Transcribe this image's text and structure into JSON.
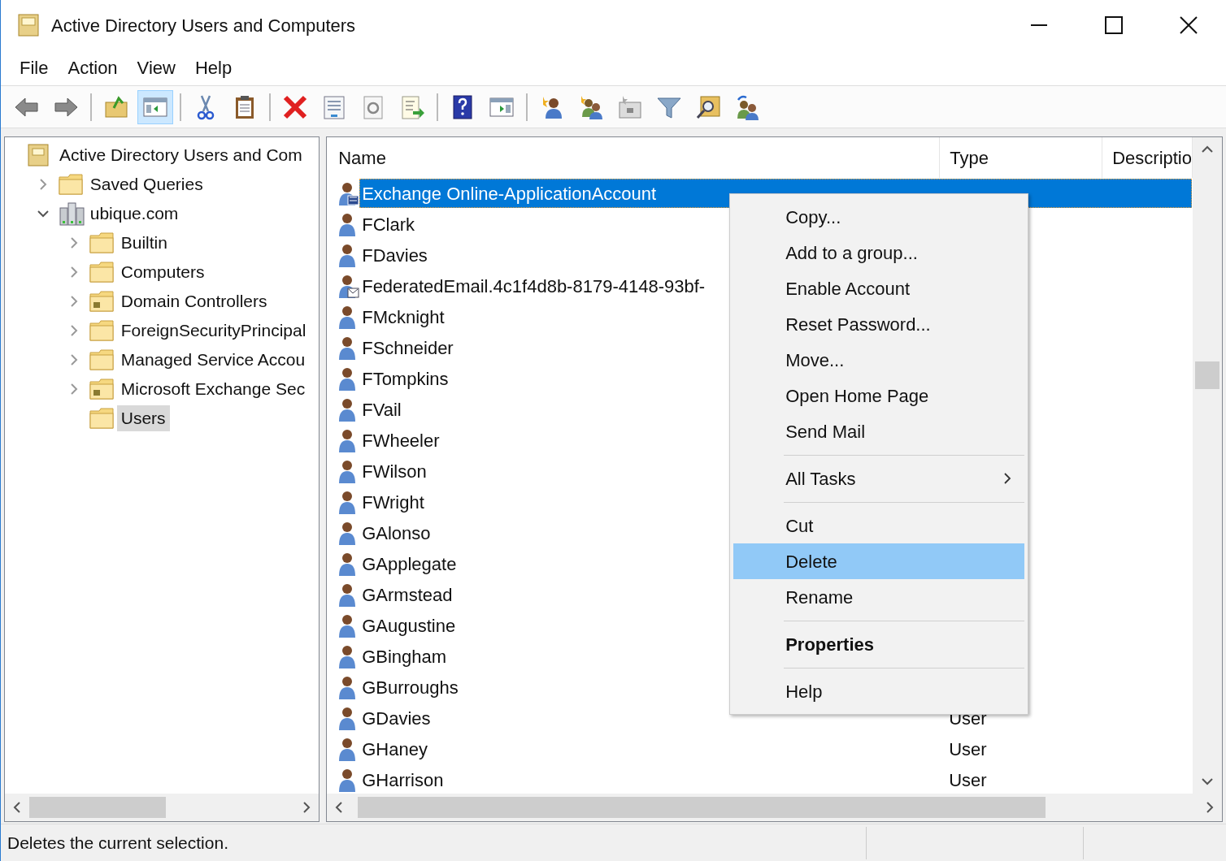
{
  "window": {
    "title": "Active Directory Users and Computers"
  },
  "menu_bar": [
    "File",
    "Action",
    "View",
    "Help"
  ],
  "toolbar": [
    [
      {
        "kind": "back",
        "pressed": false
      },
      {
        "kind": "forward",
        "pressed": false
      }
    ],
    [
      {
        "kind": "up-folder",
        "pressed": false
      },
      {
        "kind": "console-tree",
        "pressed": true
      }
    ],
    [
      {
        "kind": "cut",
        "pressed": false
      },
      {
        "kind": "paste",
        "pressed": false
      }
    ],
    [
      {
        "kind": "delete",
        "pressed": false
      },
      {
        "kind": "properties",
        "pressed": false
      },
      {
        "kind": "refresh",
        "pressed": false
      },
      {
        "kind": "export",
        "pressed": false
      }
    ],
    [
      {
        "kind": "help",
        "pressed": false
      },
      {
        "kind": "action-pane",
        "pressed": false
      }
    ],
    [
      {
        "kind": "new-user",
        "pressed": false
      },
      {
        "kind": "new-group",
        "pressed": false
      },
      {
        "kind": "new-ou",
        "pressed": false
      },
      {
        "kind": "filter",
        "pressed": false
      },
      {
        "kind": "find",
        "pressed": false
      },
      {
        "kind": "add-to-group",
        "pressed": false
      }
    ]
  ],
  "tree": [
    {
      "label": "Active Directory Users and Com",
      "kind": "snapin",
      "selected": false,
      "children": [
        {
          "label": "Saved Queries",
          "kind": "folder",
          "expanded": false,
          "selected": false
        },
        {
          "label": "ubique.com",
          "kind": "domain",
          "expanded": true,
          "selected": false,
          "children": [
            {
              "label": "Builtin",
              "kind": "folder",
              "expanded": false,
              "selected": false
            },
            {
              "label": "Computers",
              "kind": "folder",
              "expanded": false,
              "selected": false
            },
            {
              "label": "Domain Controllers",
              "kind": "ou",
              "expanded": false,
              "selected": false
            },
            {
              "label": "ForeignSecurityPrincipal",
              "kind": "folder",
              "expanded": false,
              "selected": false
            },
            {
              "label": "Managed Service Accou",
              "kind": "folder",
              "expanded": false,
              "selected": false
            },
            {
              "label": "Microsoft Exchange Sec",
              "kind": "ou",
              "expanded": false,
              "selected": false
            },
            {
              "label": "Users",
              "kind": "folder",
              "selected": true
            }
          ]
        }
      ]
    }
  ],
  "table": {
    "columns": [
      "Name",
      "Type",
      "Descriptio"
    ],
    "rows": [
      {
        "name": "Exchange Online-ApplicationAccount",
        "kind": "app-user",
        "selected": true
      },
      {
        "name": "FClark",
        "kind": "user",
        "selected": false
      },
      {
        "name": "FDavies",
        "kind": "user",
        "selected": false
      },
      {
        "name": "FederatedEmail.4c1f4d8b-8179-4148-93bf-",
        "kind": "mail-user",
        "selected": false
      },
      {
        "name": "FMcknight",
        "kind": "user",
        "selected": false
      },
      {
        "name": "FSchneider",
        "kind": "user",
        "selected": false
      },
      {
        "name": "FTompkins",
        "kind": "user",
        "selected": false
      },
      {
        "name": "FVail",
        "kind": "user",
        "selected": false
      },
      {
        "name": "FWheeler",
        "kind": "user",
        "selected": false
      },
      {
        "name": "FWilson",
        "kind": "user",
        "selected": false
      },
      {
        "name": "FWright",
        "kind": "user",
        "selected": false
      },
      {
        "name": "GAlonso",
        "kind": "user",
        "selected": false
      },
      {
        "name": "GApplegate",
        "kind": "user",
        "selected": false
      },
      {
        "name": "GArmstead",
        "kind": "user",
        "selected": false
      },
      {
        "name": "GAugustine",
        "kind": "user",
        "selected": false
      },
      {
        "name": "GBingham",
        "kind": "user",
        "selected": false
      },
      {
        "name": "GBurroughs",
        "kind": "user",
        "selected": false
      },
      {
        "name": "GDavies",
        "kind": "user",
        "type": "User",
        "selected": false
      },
      {
        "name": "GHaney",
        "kind": "user",
        "type": "User",
        "selected": false
      },
      {
        "name": "GHarrison",
        "kind": "user",
        "type": "User",
        "selected": false
      }
    ]
  },
  "context_menu": [
    {
      "kind": "item",
      "label": "Copy...",
      "selected": false
    },
    {
      "kind": "item",
      "label": "Add to a group...",
      "selected": false
    },
    {
      "kind": "item",
      "label": "Enable Account",
      "selected": false
    },
    {
      "kind": "item",
      "label": "Reset Password...",
      "selected": false
    },
    {
      "kind": "item",
      "label": "Move...",
      "selected": false
    },
    {
      "kind": "item",
      "label": "Open Home Page",
      "selected": false
    },
    {
      "kind": "item",
      "label": "Send Mail",
      "selected": false
    },
    {
      "kind": "separator"
    },
    {
      "kind": "submenu",
      "label": "All Tasks",
      "selected": false
    },
    {
      "kind": "separator"
    },
    {
      "kind": "item",
      "label": "Cut",
      "selected": false
    },
    {
      "kind": "item",
      "label": "Delete",
      "selected": true
    },
    {
      "kind": "item",
      "label": "Rename",
      "selected": false
    },
    {
      "kind": "separator"
    },
    {
      "kind": "default",
      "label": "Properties",
      "selected": false
    },
    {
      "kind": "separator"
    },
    {
      "kind": "item",
      "label": "Help",
      "selected": false
    }
  ],
  "status_bar": "Deletes the current selection."
}
